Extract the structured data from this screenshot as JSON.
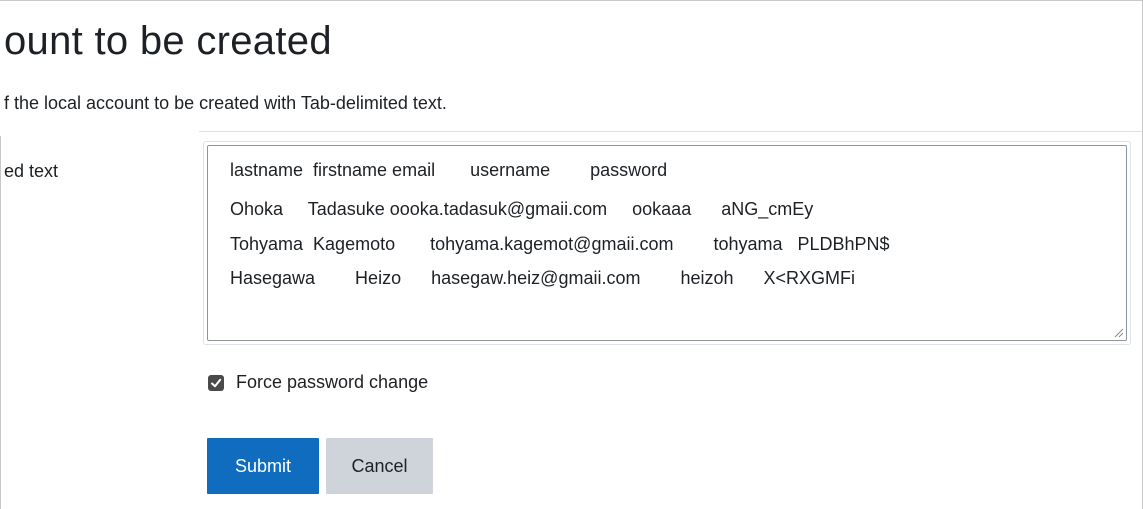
{
  "page": {
    "title": "ount to be created",
    "description": "f the local account to be created with Tab-delimited text."
  },
  "field": {
    "label": "ed text",
    "lines": [
      "lastname  firstname email       username        password",
      "Ohoka     Tadasuke oooka.tadasuk@gmaii.com     ookaaa      aNG_cmEy",
      "Tohyama  Kagemoto       tohyama.kagemot@gmaii.com        tohyama   PLDBhPN$",
      "Hasegawa        Heizo      hasegaw.heiz@gmaii.com        heizoh      X<RXGMFi"
    ]
  },
  "checkbox": {
    "label": "Force password change",
    "checked": true
  },
  "buttons": {
    "submit": "Submit",
    "cancel": "Cancel"
  },
  "colors": {
    "primary": "#0f6cbf",
    "secondary": "#ced4da",
    "text": "#1d2125"
  }
}
